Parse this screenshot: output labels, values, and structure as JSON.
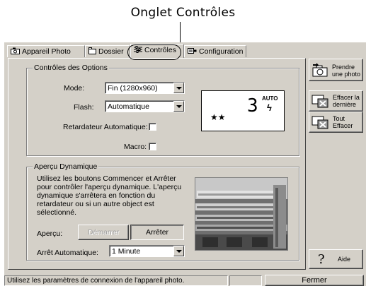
{
  "callout": {
    "label": "Onglet Contrôles"
  },
  "tabs": [
    {
      "label": "Appareil Photo",
      "icon": "camera-icon",
      "active": false
    },
    {
      "label": "Dossier",
      "icon": "folder-icon",
      "active": false
    },
    {
      "label": "Contrôles",
      "icon": "sliders-icon",
      "active": true
    },
    {
      "label": "Configuration",
      "icon": "configuration-icon",
      "active": false
    }
  ],
  "options": {
    "title": "Contrôles des Options",
    "mode_label": "Mode:",
    "mode_value": "Fin (1280x960)",
    "flash_label": "Flash:",
    "flash_value": "Automatique",
    "timer_label": "Retardateur Automatique:",
    "timer_checked": false,
    "macro_label": "Macro:",
    "macro_checked": false
  },
  "lcd": {
    "count": "3",
    "mode": "AUTO",
    "flash_symbol": "ϟ",
    "quality": "★★"
  },
  "preview": {
    "title": "Aperçu Dynamique",
    "description": "Utilisez les boutons Commencer et Arrêter pour contrôler l'aperçu dynamique. L'aperçu dynamique s'arrêtera en fonction du retardateur ou si un autre object est sélectionné.",
    "apercu_label": "Aperçu:",
    "start_button": "Démarrer",
    "stop_button": "Arrêter",
    "auto_stop_label": "Arrêt Automatique:",
    "auto_stop_value": "1 Minute"
  },
  "sidebar": {
    "take_photo": "Prendre une photo",
    "erase_last": "Effacer la dernière",
    "erase_all": "Tout Effacer",
    "help": "Aide"
  },
  "statusbar": {
    "message": "Utilisez les paramètres de connexion de l'appareil photo.",
    "close_button": "Fermer"
  }
}
